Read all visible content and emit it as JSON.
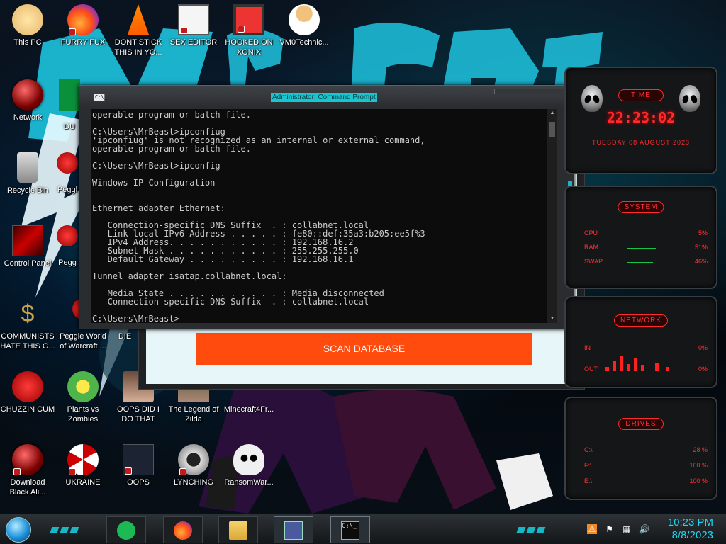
{
  "desktop": {
    "icons": [
      {
        "label": "This PC",
        "icon": "cartoon-face-icon"
      },
      {
        "label": "FURRY FUX",
        "icon": "firefox-icon"
      },
      {
        "label": "DONT STICK THIS IN YO...",
        "icon": "vlc-cone-icon"
      },
      {
        "label": "SEX EDITOR",
        "icon": "hxd-editor-icon"
      },
      {
        "label": "HOOKED ON XONIX",
        "icon": "maze-game-icon"
      },
      {
        "label": "VM0Technic...",
        "icon": "doctor-icon"
      },
      {
        "label": "Network",
        "icon": "red-orb-icon"
      },
      {
        "label": "DU",
        "icon": "app-icon"
      },
      {
        "label": "Recycle Bin",
        "icon": "recycle-bin-icon"
      },
      {
        "label": "Peggl",
        "icon": "peggle-icon"
      },
      {
        "label": "Control Panel",
        "icon": "control-panel-icon"
      },
      {
        "label": "Pegg",
        "icon": "peggle-icon"
      },
      {
        "label": "COMMUNISTS HATE THIS G...",
        "icon": "money-bag-icon"
      },
      {
        "label": "Peggle World of Warcraft ...",
        "icon": "peggle-icon"
      },
      {
        "label": "DIE",
        "icon": "app-icon"
      },
      {
        "label": "CHUZZIN CUM",
        "icon": "chuzzle-icon"
      },
      {
        "label": "Plants vs Zombies",
        "icon": "plant-icon"
      },
      {
        "label": "OOPS DID I DO THAT",
        "icon": "person-icon"
      },
      {
        "label": "The Legend of Zilda",
        "icon": "game-icon"
      },
      {
        "label": "Minecraft4Fr...",
        "icon": "minecraft-icon"
      },
      {
        "label": "Download Black Ali...",
        "icon": "red-orb-icon"
      },
      {
        "label": "UKRAINE",
        "icon": "radiation-icon"
      },
      {
        "label": "OOPS",
        "icon": "app-icon"
      },
      {
        "label": "LYNCHING",
        "icon": "gear-flag-icon"
      },
      {
        "label": "RansomWar...",
        "icon": "skull-icon"
      }
    ]
  },
  "background_app": {
    "scan_button": "SCAN DATABASE"
  },
  "cmd": {
    "sys_icon": "C:\\_",
    "title": "Administrator: Command Prompt",
    "console": "operable program or batch file.\n\nC:\\Users\\MrBeast>ipconfiug\n'ipconfiug' is not recognized as an internal or external command,\noperable program or batch file.\n\nC:\\Users\\MrBeast>ipconfig\n\nWindows IP Configuration\n\n\nEthernet adapter Ethernet:\n\n   Connection-specific DNS Suffix  . : collabnet.local\n   Link-local IPv6 Address . . . . . : fe80::def:35a3:b205:ee5f%3\n   IPv4 Address. . . . . . . . . . . : 192.168.16.2\n   Subnet Mask . . . . . . . . . . . : 255.255.255.0\n   Default Gateway . . . . . . . . . : 192.168.16.1\n\nTunnel adapter isatap.collabnet.local:\n\n   Media State . . . . . . . . . . . : Media disconnected\n   Connection-specific DNS Suffix  . : collabnet.local\n\nC:\\Users\\MrBeast>_"
  },
  "gadgets": {
    "time": {
      "header": "TIME",
      "clock": "22:23:02",
      "date": "Tuesday 08 August 2023"
    },
    "system": {
      "header": "SYSTEM",
      "rows": [
        {
          "key": "CPU",
          "value": "5%",
          "bar_fraction": 0.05
        },
        {
          "key": "RAM",
          "value": "51%",
          "bar_fraction": 0.51
        },
        {
          "key": "SWAP",
          "value": "46%",
          "bar_fraction": 0.46
        }
      ]
    },
    "network": {
      "header": "NETWORK",
      "rows": [
        {
          "key": "IN",
          "value": "0%"
        },
        {
          "key": "OUT",
          "value": "0%"
        }
      ]
    },
    "drives": {
      "header": "DRIVES",
      "rows": [
        {
          "key": "C:\\",
          "value": "28 %"
        },
        {
          "key": "F:\\",
          "value": "100 %"
        },
        {
          "key": "E:\\",
          "value": "100 %"
        }
      ]
    }
  },
  "taskbar": {
    "pinned": [
      {
        "icon": "spotify-icon",
        "name": "Spotify"
      },
      {
        "icon": "firefox-icon",
        "name": "Firefox"
      },
      {
        "icon": "file-explorer-icon",
        "name": "File Explorer"
      },
      {
        "icon": "app-panel-icon",
        "name": "App"
      },
      {
        "icon": "cmd-icon",
        "name": "Command Prompt",
        "glyph": "C:\\_"
      }
    ],
    "time": "10:23 PM",
    "date": "8/8/2023"
  },
  "colors": {
    "accent_cyan": "#19b6c6",
    "gadget_red": "#ff2a2a",
    "scan_button": "#ff4c0e",
    "console_bg": "#0c0c0c",
    "console_text": "#cccccc"
  }
}
